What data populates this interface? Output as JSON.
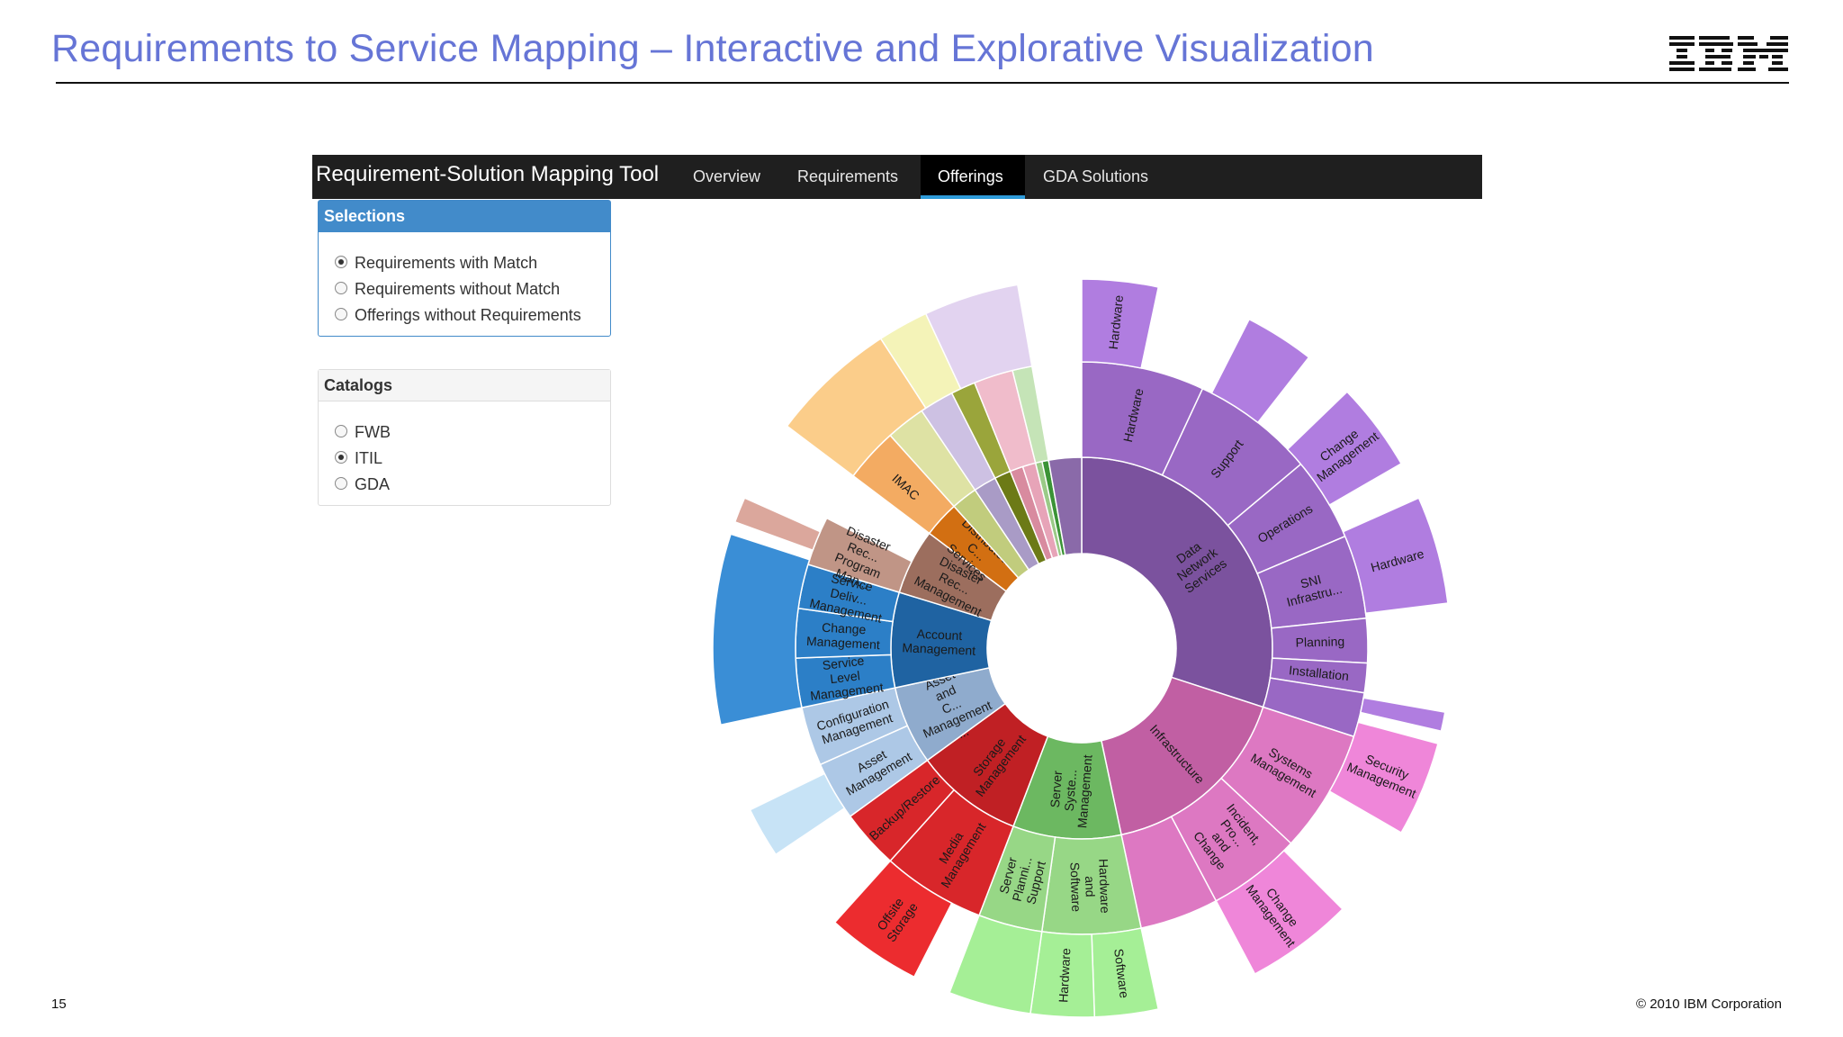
{
  "slide": {
    "title": "Requirements to Service Mapping – Interactive and Explorative Visualization",
    "logo": "IBM",
    "number": "15",
    "copyright": "© 2010 IBM Corporation"
  },
  "app": {
    "brand": "Requirement-Solution Mapping Tool",
    "tabs": [
      {
        "label": "Overview",
        "active": false
      },
      {
        "label": "Requirements",
        "active": false
      },
      {
        "label": "Offerings",
        "active": true
      },
      {
        "label": "GDA Solutions",
        "active": false
      }
    ],
    "accent_color": "#2e9bd9"
  },
  "selections": {
    "title": "Selections",
    "options": [
      {
        "label": "Requirements with Match",
        "selected": true
      },
      {
        "label": "Requirements without Match",
        "selected": false
      },
      {
        "label": "Offerings without Requirements",
        "selected": false
      }
    ]
  },
  "catalogs": {
    "title": "Catalogs",
    "options": [
      {
        "label": "FWB",
        "selected": false
      },
      {
        "label": "ITIL",
        "selected": true
      },
      {
        "label": "GDA",
        "selected": false
      }
    ]
  },
  "sunburst": {
    "type": "sunburst",
    "inner": [
      {
        "label": "Data Network Services",
        "start": 0,
        "end": 108,
        "color": "#7b529e"
      },
      {
        "label": "Infrastructure",
        "start": 108,
        "end": 168,
        "color": "#c15fa3"
      },
      {
        "label": "Server Syste... Management",
        "start": 168,
        "end": 201,
        "color": "#6cb861"
      },
      {
        "label": "Storage Management",
        "start": 201,
        "end": 234,
        "color": "#c02024"
      },
      {
        "label": "Asset and C... Management ...",
        "start": 234,
        "end": 258,
        "color": "#8fabcd"
      },
      {
        "label": "Account Management",
        "start": 258,
        "end": 287,
        "color": "#1f63a2"
      },
      {
        "label": "Disaster Rec... Management",
        "start": 287,
        "end": 307,
        "color": "#9c6e5e"
      },
      {
        "label": "Distributed C... Services",
        "start": 307,
        "end": 318,
        "color": "#d26f12"
      },
      {
        "label": "",
        "start": 318,
        "end": 326,
        "color": "#c1cc7d"
      },
      {
        "label": "",
        "start": 326,
        "end": 333,
        "color": "#a99bc6"
      },
      {
        "label": "",
        "start": 333,
        "end": 338,
        "color": "#6c7a16"
      },
      {
        "label": "",
        "start": 338,
        "end": 342,
        "color": "#d88b9f"
      },
      {
        "label": "",
        "start": 342,
        "end": 346,
        "color": "#e7a4b8"
      },
      {
        "label": "",
        "start": 346,
        "end": 348,
        "color": "#9aca87"
      },
      {
        "label": "",
        "start": 348,
        "end": 350,
        "color": "#3b9336"
      },
      {
        "label": "",
        "start": 350,
        "end": 360,
        "color": "#8a6aa9"
      }
    ],
    "middle": [
      {
        "label": "Hardware",
        "start": 0,
        "end": 25,
        "color": "#9968c4"
      },
      {
        "label": "Support",
        "start": 25,
        "end": 50,
        "color": "#9968c4"
      },
      {
        "label": "Operations",
        "start": 50,
        "end": 67,
        "color": "#9968c4"
      },
      {
        "label": "SNI Infrastru...",
        "start": 67,
        "end": 84,
        "color": "#9968c4"
      },
      {
        "label": "Planning",
        "start": 84,
        "end": 93,
        "color": "#9968c4"
      },
      {
        "label": "Installation",
        "start": 93,
        "end": 99,
        "color": "#9968c4"
      },
      {
        "label": "",
        "start": 99,
        "end": 108,
        "color": "#9968c4"
      },
      {
        "label": "Systems Management",
        "start": 108,
        "end": 133,
        "color": "#dd78c2"
      },
      {
        "label": "Incident, Pro... and Change",
        "start": 133,
        "end": 152,
        "color": "#dd78c2"
      },
      {
        "label": "",
        "start": 152,
        "end": 168,
        "color": "#dd78c2"
      },
      {
        "label": "Hardware and Software",
        "start": 168,
        "end": 188,
        "color": "#97d786"
      },
      {
        "label": "Server Planni... Support",
        "start": 188,
        "end": 201,
        "color": "#97d786"
      },
      {
        "label": "Media Management",
        "start": 201,
        "end": 222,
        "color": "#d8262a"
      },
      {
        "label": "Backup/Restore",
        "start": 222,
        "end": 234,
        "color": "#d8262a"
      },
      {
        "label": "Asset Management",
        "start": 234,
        "end": 246,
        "color": "#adc8e6"
      },
      {
        "label": "Configuration Management",
        "start": 246,
        "end": 258,
        "color": "#adc8e6"
      },
      {
        "label": "Service Level Management",
        "start": 258,
        "end": 268,
        "color": "#2c7fc7"
      },
      {
        "label": "Change Management",
        "start": 268,
        "end": 278,
        "color": "#2c7fc7"
      },
      {
        "label": "Service Deliv... Management",
        "start": 278,
        "end": 287,
        "color": "#2c7fc7"
      },
      {
        "label": "Disaster Rec... Program Man...",
        "start": 287,
        "end": 297,
        "color": "#c09586"
      },
      {
        "label": "IMAC",
        "start": 307,
        "end": 318,
        "color": "#f3ab62"
      },
      {
        "label": "",
        "start": 318,
        "end": 326,
        "color": "#dee2a4"
      },
      {
        "label": "",
        "start": 326,
        "end": 333,
        "color": "#cdc1e3"
      },
      {
        "label": "",
        "start": 333,
        "end": 338,
        "color": "#9aa53b"
      },
      {
        "label": "",
        "start": 338,
        "end": 346,
        "color": "#f0bccb"
      },
      {
        "label": "",
        "start": 346,
        "end": 350,
        "color": "#c5e4b7"
      }
    ],
    "outer": [
      {
        "label": "Hardware",
        "start": 0,
        "end": 12,
        "color": "#b07de0"
      },
      {
        "label": "",
        "start": 27,
        "end": 38,
        "color": "#b07de0"
      },
      {
        "label": "Change Management",
        "start": 46,
        "end": 60,
        "color": "#b07de0"
      },
      {
        "label": "Hardware",
        "start": 66,
        "end": 83,
        "color": "#b07de0"
      },
      {
        "label": "",
        "start": 100,
        "end": 103,
        "color": "#b07de0"
      },
      {
        "label": "Security Management",
        "start": 105,
        "end": 120,
        "color": "#ef86d9"
      },
      {
        "label": "Change Management",
        "start": 135,
        "end": 152,
        "color": "#ef86d9"
      },
      {
        "label": "Software",
        "start": 168,
        "end": 178,
        "color": "#a5ef96"
      },
      {
        "label": "Hardware",
        "start": 178,
        "end": 188,
        "color": "#a5ef96"
      },
      {
        "label": "",
        "start": 188,
        "end": 201,
        "color": "#a5ef96"
      },
      {
        "label": "Offsite Storage",
        "start": 207,
        "end": 222,
        "color": "#ec2c2f"
      },
      {
        "label": "",
        "start": 236,
        "end": 244,
        "color": "#c7e3f6"
      },
      {
        "label": "",
        "start": 258,
        "end": 288,
        "color": "#3a8ed6"
      },
      {
        "label": "",
        "start": 290,
        "end": 294,
        "color": "#dba79c"
      },
      {
        "label": "",
        "start": 307,
        "end": 327,
        "color": "#fbcd8a"
      },
      {
        "label": "",
        "start": 327,
        "end": 335,
        "color": "#f4f3b8"
      },
      {
        "label": "",
        "start": 335,
        "end": 350,
        "color": "#e2d3f0"
      }
    ]
  }
}
